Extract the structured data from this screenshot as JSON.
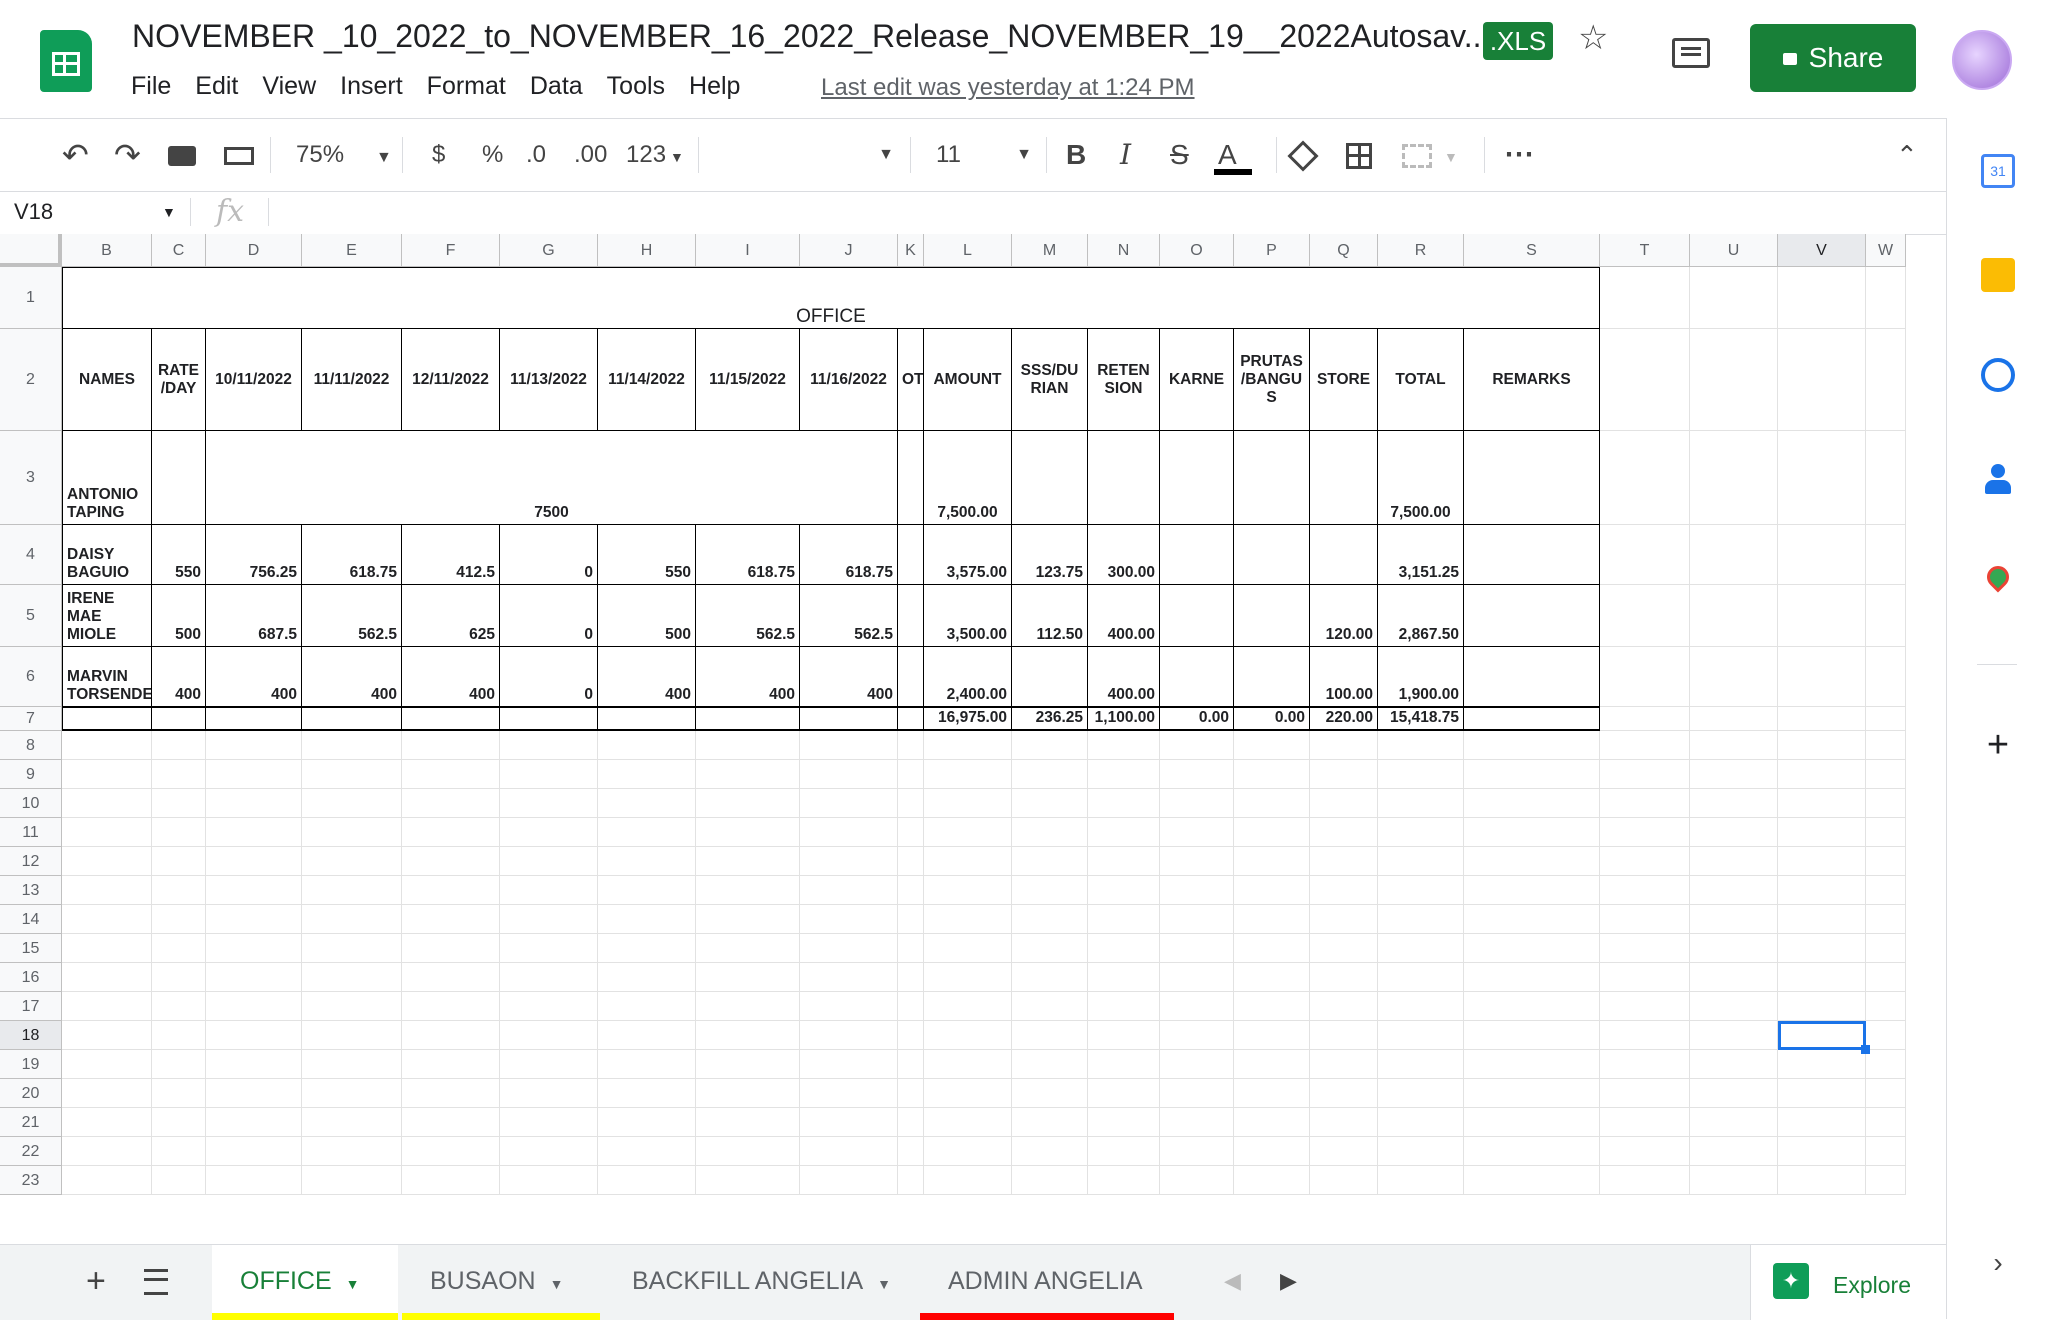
{
  "header": {
    "doc_title": "NOVEMBER _10_2022_to_NOVEMBER_16_2022_Release_NOVEMBER_19__2022Autosav...",
    "file_badge": ".XLS",
    "menu": [
      "File",
      "Edit",
      "View",
      "Insert",
      "Format",
      "Data",
      "Tools",
      "Help"
    ],
    "last_edit": "Last edit was yesterday at 1:24 PM",
    "share_label": "Share"
  },
  "toolbar": {
    "zoom": "75%",
    "currency": "$",
    "percent": "%",
    "decrease_decimal": ".0",
    "increase_decimal": ".00",
    "more_formats": "123",
    "font_size": "11",
    "bold": "B",
    "italic": "I",
    "strike": "S",
    "text_color": "A",
    "more": "⋯"
  },
  "formula_bar": {
    "name_box": "V18",
    "fx": "fx",
    "formula": ""
  },
  "grid": {
    "columns": [
      "B",
      "C",
      "D",
      "E",
      "F",
      "G",
      "H",
      "I",
      "J",
      "K",
      "L",
      "M",
      "N",
      "O",
      "P",
      "Q",
      "R",
      "S",
      "T",
      "U",
      "V",
      "W"
    ],
    "selected_column": "V",
    "rows": [
      "1",
      "2",
      "3",
      "4",
      "5",
      "6",
      "7",
      "8",
      "9",
      "10",
      "11",
      "12",
      "13",
      "14",
      "15",
      "16",
      "17",
      "18",
      "19",
      "20",
      "21",
      "22",
      "23"
    ],
    "selected_row": "18",
    "title": "OFFICE",
    "headers": [
      "NAMES",
      "RATE /DAY",
      "10/11/2022",
      "11/11/2022",
      "12/11/2022",
      "11/13/2022",
      "11/14/2022",
      "11/15/2022",
      "11/16/2022",
      "OT",
      "AMOUNT",
      "SSS/DU RIAN",
      "RETEN SION",
      "KARNE",
      "PRUTAS /BANGU S",
      "STORE",
      "TOTAL",
      "REMARKS"
    ],
    "records": [
      {
        "name": "ANTONIO TAPING",
        "rate": "",
        "d1": "",
        "d2": "",
        "d3": "",
        "d4": "7500",
        "d5": "",
        "d6": "",
        "d7": "",
        "ot": "",
        "amount": "7,500.00",
        "sss": "",
        "retension": "",
        "karne": "",
        "prutas": "",
        "store": "",
        "total": "7,500.00",
        "remarks": ""
      },
      {
        "name": "DAISY BAGUIO",
        "rate": "550",
        "d1": "756.25",
        "d2": "618.75",
        "d3": "412.5",
        "d4": "0",
        "d5": "550",
        "d6": "618.75",
        "d7": "618.75",
        "ot": "",
        "amount": "3,575.00",
        "sss": "123.75",
        "retension": "300.00",
        "karne": "",
        "prutas": "",
        "store": "",
        "total": "3,151.25",
        "remarks": ""
      },
      {
        "name": "IRENE MAE MIOLE",
        "rate": "500",
        "d1": "687.5",
        "d2": "562.5",
        "d3": "625",
        "d4": "0",
        "d5": "500",
        "d6": "562.5",
        "d7": "562.5",
        "ot": "",
        "amount": "3,500.00",
        "sss": "112.50",
        "retension": "400.00",
        "karne": "",
        "prutas": "",
        "store": "120.00",
        "total": "2,867.50",
        "remarks": ""
      },
      {
        "name": "MARVIN TORSENDE",
        "rate": "400",
        "d1": "400",
        "d2": "400",
        "d3": "400",
        "d4": "0",
        "d5": "400",
        "d6": "400",
        "d7": "400",
        "ot": "",
        "amount": "2,400.00",
        "sss": "",
        "retension": "400.00",
        "karne": "",
        "prutas": "",
        "store": "100.00",
        "total": "1,900.00",
        "remarks": ""
      }
    ],
    "totals": {
      "amount": "16,975.00",
      "sss": "236.25",
      "retension": "1,100.00",
      "karne": "0.00",
      "prutas": "0.00",
      "store": "220.00",
      "total": "15,418.75"
    }
  },
  "sheets": [
    {
      "label": "OFFICE",
      "active": true,
      "color": "#ffff00"
    },
    {
      "label": "BUSAON",
      "active": false,
      "color": "#ffff00"
    },
    {
      "label": "BACKFILL ANGELIA",
      "active": false,
      "color": ""
    },
    {
      "label": "ADMIN ANGELIA",
      "active": false,
      "color": "#ff0000"
    }
  ],
  "explore_label": "Explore",
  "colors": {
    "accent": "#1a73e8",
    "brand": "#188038",
    "sheets_green": "#0f9d58"
  },
  "icons": [
    "undo-icon",
    "redo-icon",
    "print-icon",
    "paint-format-icon",
    "fill-color-icon",
    "borders-icon",
    "merge-icon",
    "collapse-icon",
    "calendar-icon",
    "keep-icon",
    "tasks-icon",
    "contacts-icon",
    "maps-icon",
    "add-icon",
    "chevron-right-icon",
    "star-icon",
    "comment-icon",
    "lock-icon"
  ]
}
